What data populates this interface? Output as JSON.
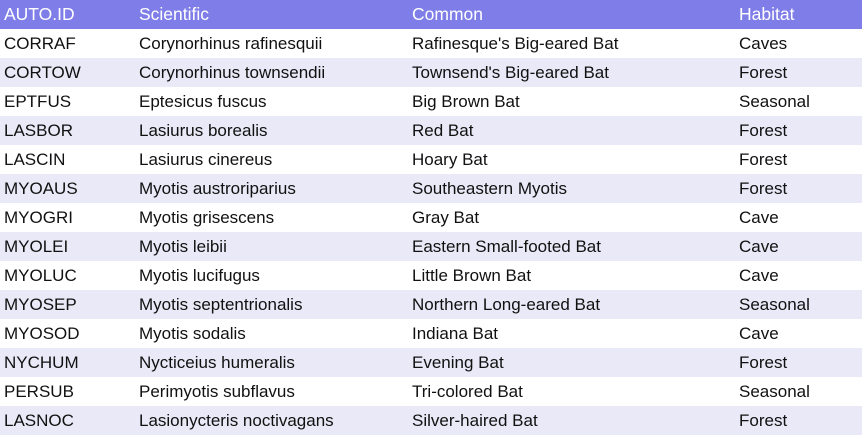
{
  "table": {
    "headers": [
      "AUTO.ID",
      "Scientific",
      "Common",
      "Habitat"
    ],
    "rows": [
      [
        "CORRAF",
        "Corynorhinus rafinesquii",
        "Rafinesque's Big-eared Bat",
        "Caves"
      ],
      [
        "CORTOW",
        "Corynorhinus townsendii",
        "Townsend's Big-eared Bat",
        "Forest"
      ],
      [
        "EPTFUS",
        "Eptesicus fuscus",
        "Big Brown Bat",
        "Seasonal"
      ],
      [
        "LASBOR",
        "Lasiurus borealis",
        "Red Bat",
        "Forest"
      ],
      [
        "LASCIN",
        "Lasiurus cinereus",
        "Hoary Bat",
        "Forest"
      ],
      [
        "MYOAUS",
        "Myotis austroriparius",
        "Southeastern Myotis",
        "Forest"
      ],
      [
        "MYOGRI",
        "Myotis grisescens",
        "Gray Bat",
        "Cave"
      ],
      [
        "MYOLEI",
        "Myotis leibii",
        "Eastern Small-footed Bat",
        "Cave"
      ],
      [
        "MYOLUC",
        "Myotis lucifugus",
        "Little Brown Bat",
        "Cave"
      ],
      [
        "MYOSEP",
        "Myotis septentrionalis",
        "Northern Long-eared Bat",
        "Seasonal"
      ],
      [
        "MYOSOD",
        "Myotis sodalis",
        "Indiana Bat",
        "Cave"
      ],
      [
        "NYCHUM",
        "Nycticeius humeralis",
        "Evening Bat",
        "Forest"
      ],
      [
        "PERSUB",
        "Perimyotis subflavus",
        "Tri-colored Bat",
        "Seasonal"
      ],
      [
        "LASNOC",
        "Lasionycteris noctivagans",
        "Silver-haired Bat",
        "Forest"
      ]
    ]
  },
  "colors": {
    "header_background": "#7f7ee8",
    "header_text": "#ffffff",
    "row_even": "#ffffff",
    "row_odd": "#e9e9f7"
  }
}
